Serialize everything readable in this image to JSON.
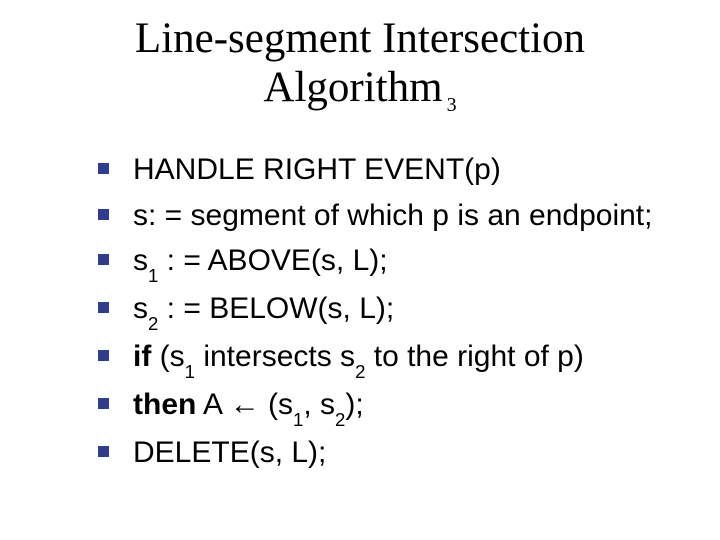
{
  "title": {
    "line1": "Line-segment Intersection",
    "line2": "Algorithm",
    "sub": "3"
  },
  "items": [
    {
      "html": "HANDLE RIGHT EVENT(p)"
    },
    {
      "html": "s: = segment of which p is an endpoint;"
    },
    {
      "html": "s<sub class=\"s\">1</sub> : = ABOVE(s, L);"
    },
    {
      "html": "s<sub class=\"s\">2</sub> : = BELOW(s, L);"
    },
    {
      "html": "<b>if</b> (s<sub class=\"s\">1</sub> intersects s<sub class=\"s\">2</sub> to the right of p)"
    },
    {
      "html": "<b>then</b> A ← (s<sub class=\"s\">1</sub>, s<sub class=\"s\">2</sub>);"
    },
    {
      "html": "DELETE(s, L);"
    }
  ]
}
